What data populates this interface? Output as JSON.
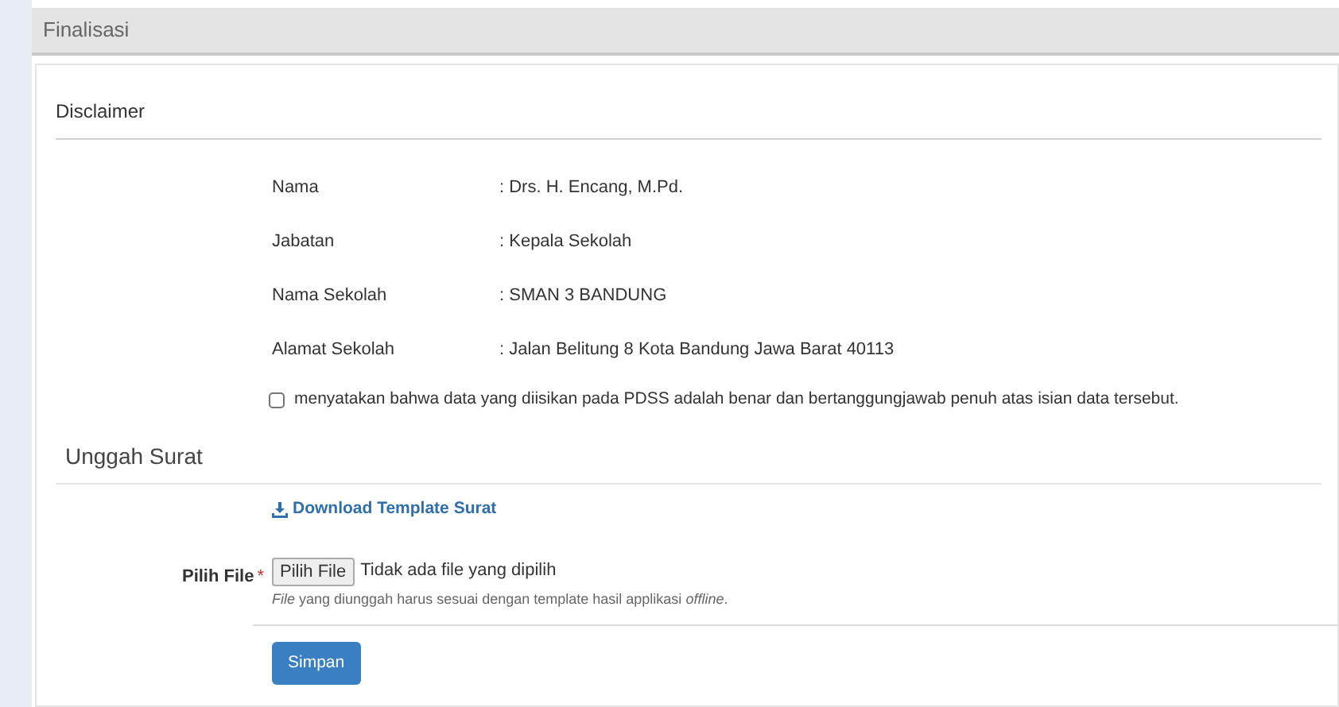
{
  "header": {
    "title": "Finalisasi"
  },
  "disclaimer": {
    "title": "Disclaimer",
    "fields": [
      {
        "label": "Nama",
        "value": ": Drs. H. Encang, M.Pd."
      },
      {
        "label": "Jabatan",
        "value": ": Kepala Sekolah"
      },
      {
        "label": "Nama Sekolah",
        "value": ": SMAN 3 BANDUNG"
      },
      {
        "label": "Alamat Sekolah",
        "value": ": Jalan Belitung 8 Kota Bandung Jawa Barat 40113"
      }
    ],
    "agreement": {
      "label": "menyatakan bahwa data yang diisikan pada PDSS adalah benar dan bertanggungjawab penuh atas isian data tersebut.",
      "checked": false
    }
  },
  "upload": {
    "title": "Unggah Surat",
    "download_link": "Download Template Surat",
    "file_label": "Pilih File",
    "required_mark": "*",
    "file_button": "Pilih File",
    "file_status": "Tidak ada file yang dipilih",
    "help": "*File* yang diunggah harus sesuai dengan template hasil applikasi *offline*.",
    "submit": "Simpan"
  }
}
